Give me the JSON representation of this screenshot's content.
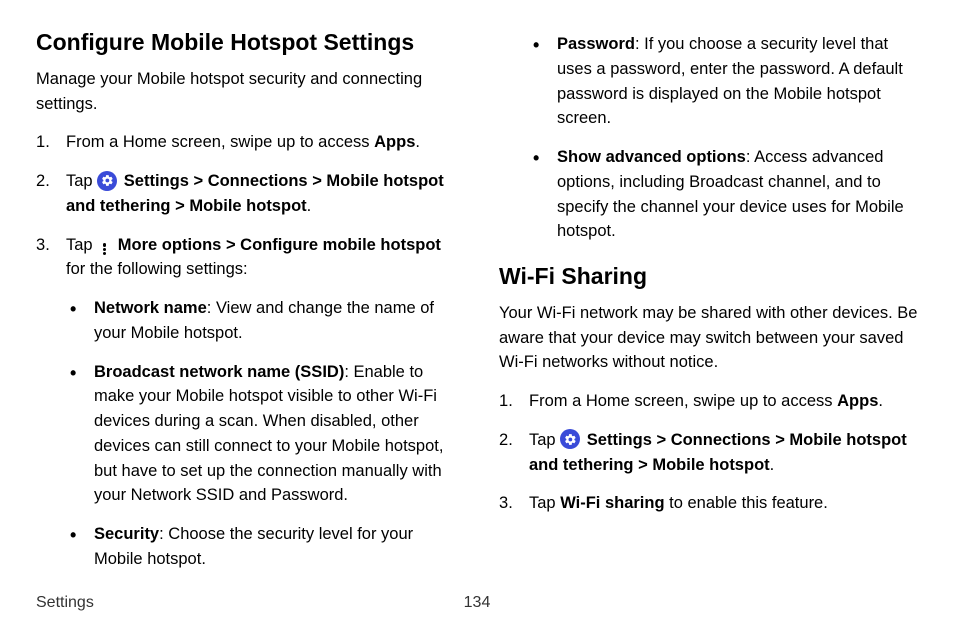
{
  "left": {
    "heading": "Configure Mobile Hotspot Settings",
    "intro": "Manage your Mobile hotspot security and connecting settings.",
    "step1_a": "From a Home screen, swipe up to access ",
    "step1_b": "Apps",
    "step1_c": ".",
    "step2_a": "Tap ",
    "step2_b": "Settings",
    "step2_c": " > ",
    "step2_d": "Connections",
    "step2_e": " > ",
    "step2_f": "Mobile hotspot and tethering",
    "step2_g": " > ",
    "step2_h": "Mobile hotspot",
    "step2_i": ".",
    "step3_a": "Tap ",
    "step3_b": "More options",
    "step3_c": " > ",
    "step3_d": "Configure mobile hotspot",
    "step3_e": " for the following settings:",
    "bullet1_a": "Network name",
    "bullet1_b": ": View and change the name of your Mobile hotspot.",
    "bullet2_a": "Broadcast network name (SSID)",
    "bullet2_b": ": Enable to make your Mobile hotspot visible to other Wi-Fi devices during a scan. When disabled, other devices can still connect to your Mobile hotspot, but have to set up the connection manually with your Network SSID and Password.",
    "bullet3_a": "Security",
    "bullet3_b": ": Choose the security level for your Mobile hotspot."
  },
  "right": {
    "bullet4_a": "Password",
    "bullet4_b": ": If you choose a security level that uses a password, enter the password. A default password is displayed on the Mobile hotspot screen.",
    "bullet5_a": "Show advanced options",
    "bullet5_b": ": Access advanced options, including Broadcast channel, and to specify the channel your device uses for Mobile hotspot.",
    "heading": "Wi-Fi Sharing",
    "intro": "Your Wi-Fi network may be shared with other devices. Be aware that your device may switch between your saved Wi-Fi networks without notice.",
    "step1_a": "From a Home screen, swipe up to access ",
    "step1_b": "Apps",
    "step1_c": ".",
    "step2_a": "Tap ",
    "step2_b": "Settings",
    "step2_c": " > ",
    "step2_d": "Connections",
    "step2_e": " > ",
    "step2_f": "Mobile hotspot and tethering",
    "step2_g": " > ",
    "step2_h": "Mobile hotspot",
    "step2_i": ".",
    "step3_a": "Tap ",
    "step3_b": "Wi-Fi sharing",
    "step3_c": " to enable this feature."
  },
  "footer": {
    "section": "Settings",
    "page": "134"
  }
}
